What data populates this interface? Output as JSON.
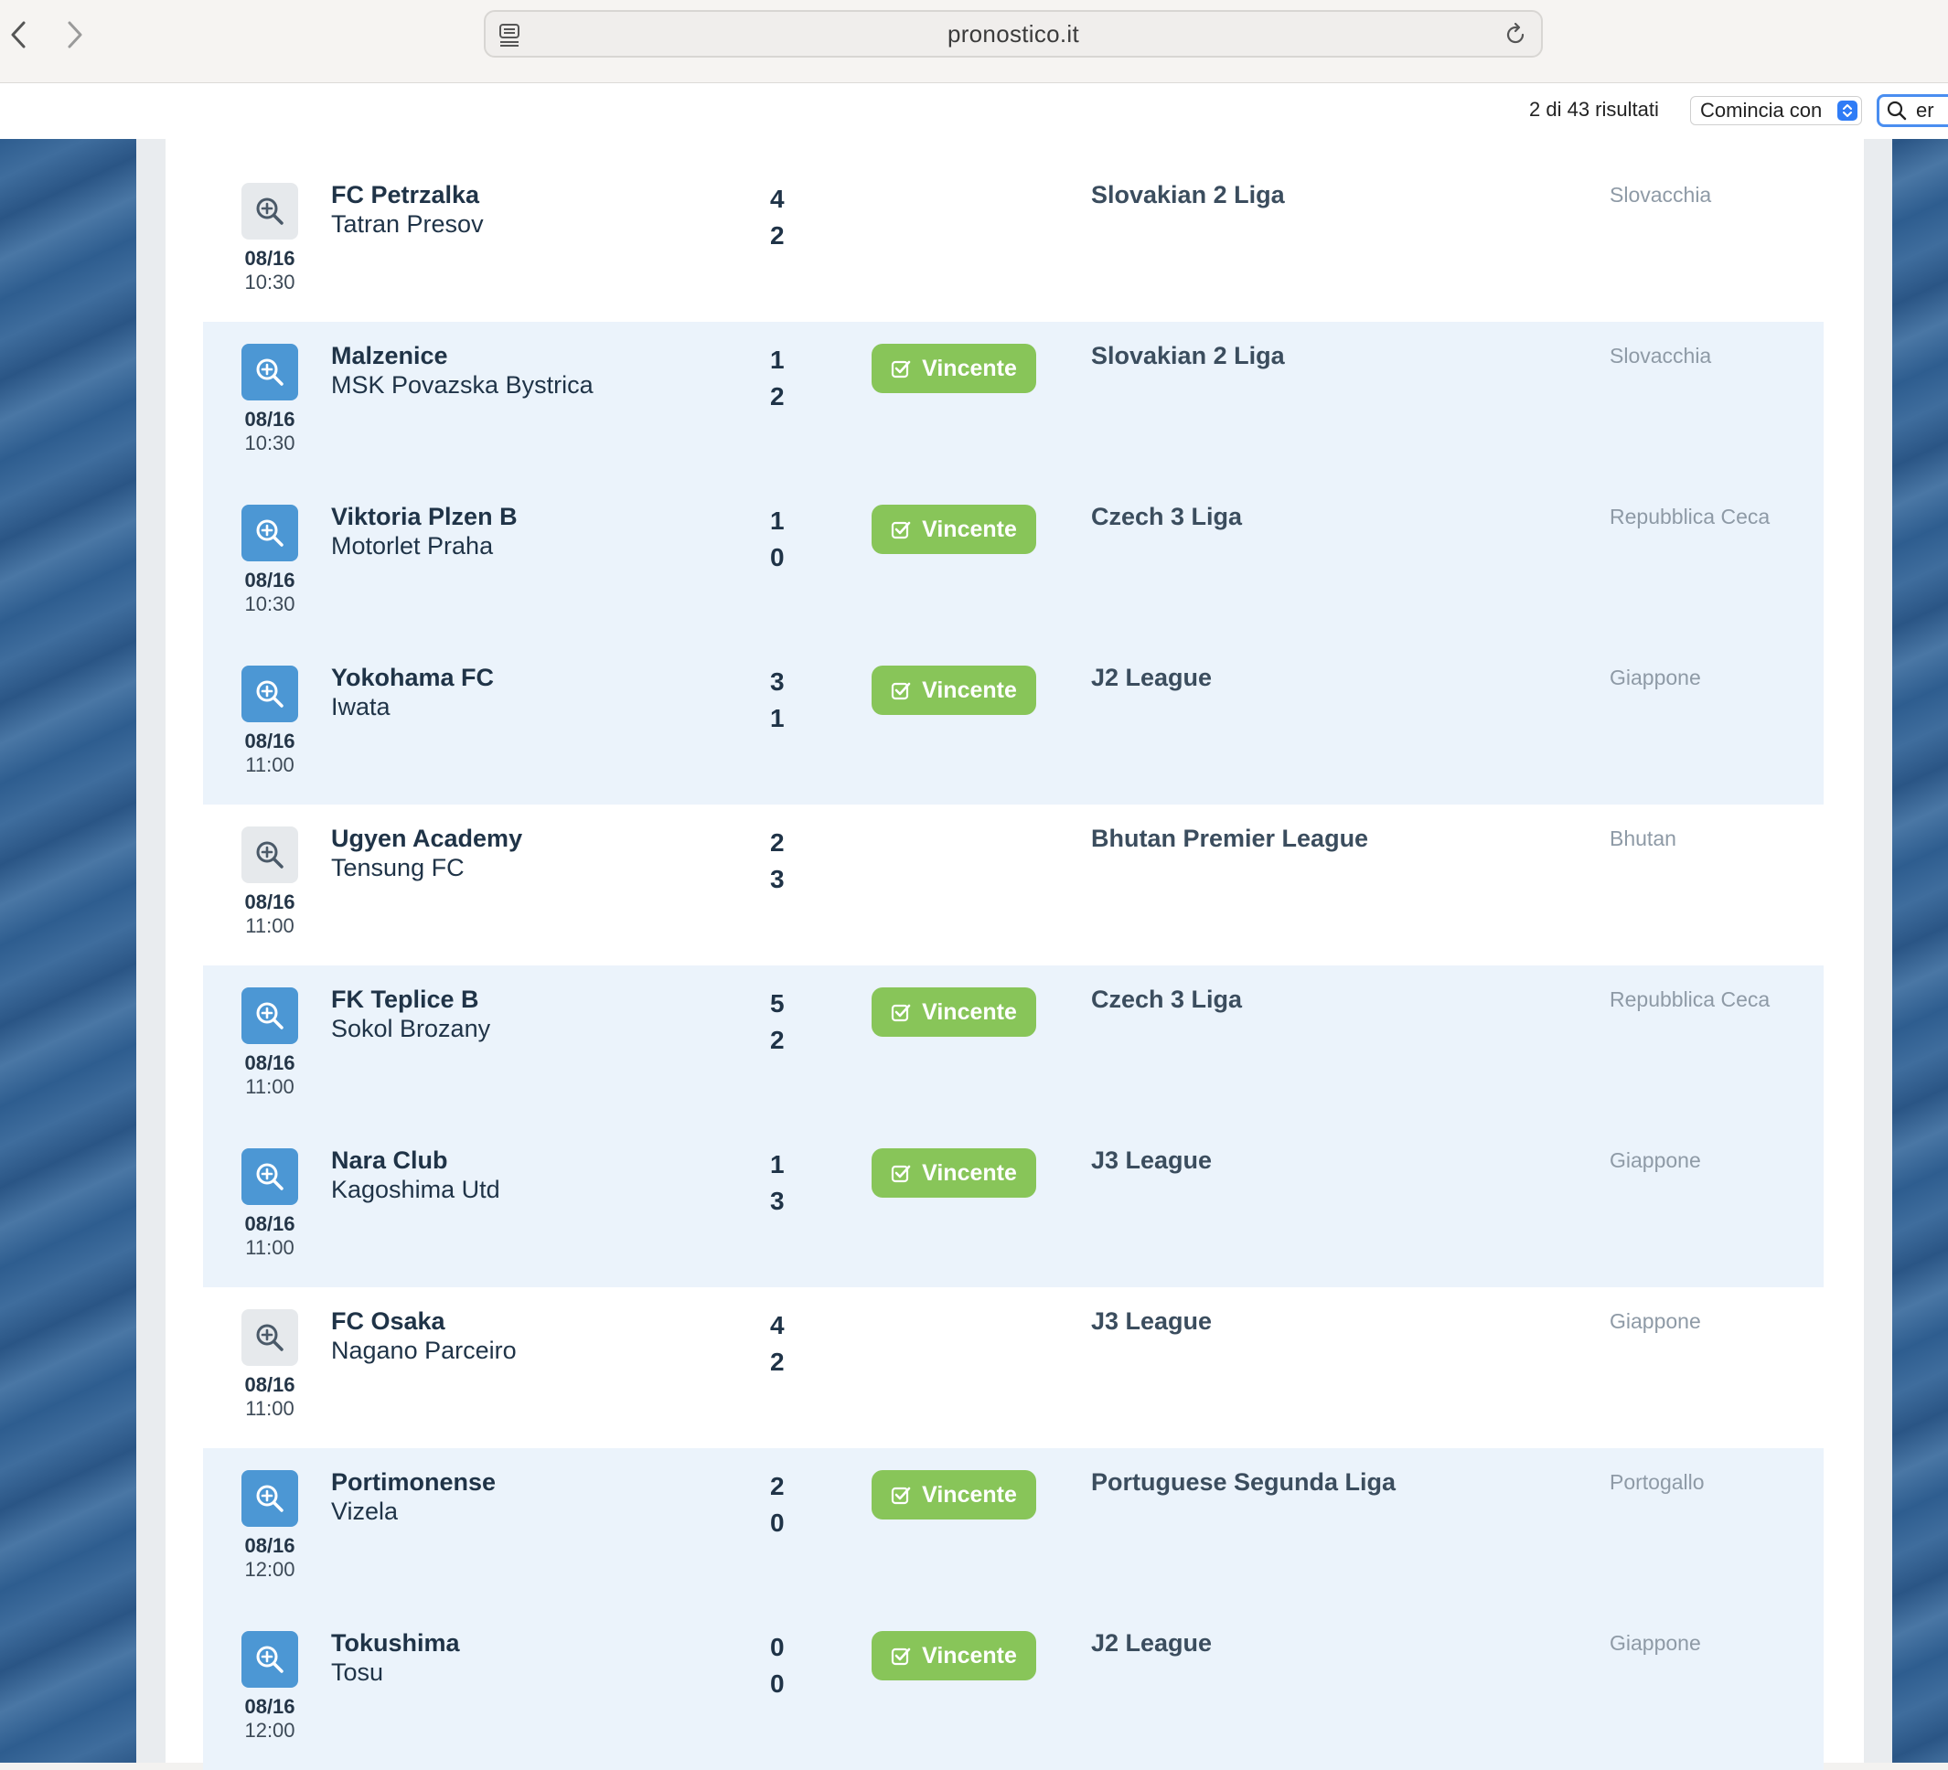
{
  "browser": {
    "url": "pronostico.it",
    "icons": {
      "back": "chevron-left-icon",
      "forward": "chevron-right-icon",
      "site": "page-icon",
      "reload": "reload-icon"
    }
  },
  "findbar": {
    "results": "2 di 43 risultati",
    "mode": "Comincia con",
    "query": "er"
  },
  "colors": {
    "accent": "#4c97d4",
    "badge": "#88c559",
    "row_highlight": "#ebf3fb"
  },
  "matches": [
    {
      "date": "08/16",
      "time": "10:30",
      "home": "FC Petrzalka",
      "away": "Tatran Presov",
      "score_home": "4",
      "score_away": "2",
      "badge": "",
      "league": "Slovakian 2 Liga",
      "country": "Slovacchia",
      "highlight": false
    },
    {
      "date": "08/16",
      "time": "10:30",
      "home": "Malzenice",
      "away": "MSK Povazska Bystrica",
      "score_home": "1",
      "score_away": "2",
      "badge": "Vincente",
      "league": "Slovakian 2 Liga",
      "country": "Slovacchia",
      "highlight": true
    },
    {
      "date": "08/16",
      "time": "10:30",
      "home": "Viktoria Plzen B",
      "away": "Motorlet Praha",
      "score_home": "1",
      "score_away": "0",
      "badge": "Vincente",
      "league": "Czech 3 Liga",
      "country": "Repubblica Ceca",
      "highlight": true
    },
    {
      "date": "08/16",
      "time": "11:00",
      "home": "Yokohama FC",
      "away": "Iwata",
      "score_home": "3",
      "score_away": "1",
      "badge": "Vincente",
      "league": "J2 League",
      "country": "Giappone",
      "highlight": true
    },
    {
      "date": "08/16",
      "time": "11:00",
      "home": "Ugyen Academy",
      "away": "Tensung FC",
      "score_home": "2",
      "score_away": "3",
      "badge": "",
      "league": "Bhutan Premier League",
      "country": "Bhutan",
      "highlight": false
    },
    {
      "date": "08/16",
      "time": "11:00",
      "home": "FK Teplice B",
      "away": "Sokol Brozany",
      "score_home": "5",
      "score_away": "2",
      "badge": "Vincente",
      "league": "Czech 3 Liga",
      "country": "Repubblica Ceca",
      "highlight": true
    },
    {
      "date": "08/16",
      "time": "11:00",
      "home": "Nara Club",
      "away": "Kagoshima Utd",
      "score_home": "1",
      "score_away": "3",
      "badge": "Vincente",
      "league": "J3 League",
      "country": "Giappone",
      "highlight": true
    },
    {
      "date": "08/16",
      "time": "11:00",
      "home": "FC Osaka",
      "away": "Nagano Parceiro",
      "score_home": "4",
      "score_away": "2",
      "badge": "",
      "league": "J3 League",
      "country": "Giappone",
      "highlight": false
    },
    {
      "date": "08/16",
      "time": "12:00",
      "home": "Portimonense",
      "away": "Vizela",
      "score_home": "2",
      "score_away": "0",
      "badge": "Vincente",
      "league": "Portuguese Segunda Liga",
      "country": "Portogallo",
      "highlight": true
    },
    {
      "date": "08/16",
      "time": "12:00",
      "home": "Tokushima",
      "away": "Tosu",
      "score_home": "0",
      "score_away": "0",
      "badge": "Vincente",
      "league": "J2 League",
      "country": "Giappone",
      "highlight": true
    }
  ]
}
